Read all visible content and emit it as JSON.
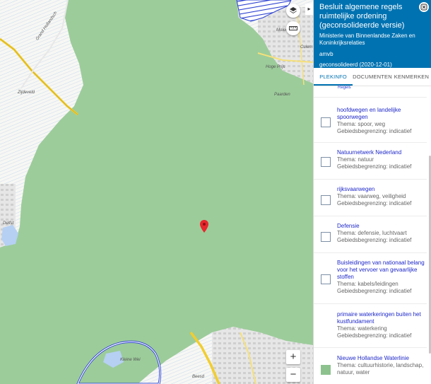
{
  "map": {
    "labels": {
      "zijdeveld": "Zijdeveld",
      "grand": "Grand Hollandsch",
      "molen": "Molen",
      "culemborg": "Culem",
      "hoge_prijs": "Hoge Prijs",
      "paarden": "Paarden",
      "delft": "Delfst",
      "kleine": "Kleine Wei",
      "beesd": "Beesd"
    },
    "zoom_in": "+",
    "zoom_out": "−",
    "collapse": "▸"
  },
  "panel": {
    "title": "Besluit algemene regels ruimtelijke ordening (geconsolideerde versie)",
    "publisher": "Ministerie van Binnenlandse Zaken en Koninkrijksrelaties",
    "type": "amvb",
    "status": "geconsolideerd (2020-12-01)",
    "tabs": [
      "PLEKINFO",
      "DOCUMENTEN",
      "KENMERKEN"
    ],
    "regels_link": "Regels",
    "items": [
      {
        "title": "hoofdwegen en landelijke spoorwegen",
        "thema": "Thema: spoor, weg",
        "grens": "Gebiedsbegrenzing: indicatief"
      },
      {
        "title": "Natuurnetwerk Nederland",
        "thema": "Thema: natuur",
        "grens": "Gebiedsbegrenzing: indicatief"
      },
      {
        "title": "rijksvaarwegen",
        "thema": "Thema: vaarweg, veiligheid",
        "grens": "Gebiedsbegrenzing: indicatief"
      },
      {
        "title": "Defensie",
        "thema": "Thema: defensie, luchtvaart",
        "grens": "Gebiedsbegrenzing: indicatief"
      },
      {
        "title": "Buisleidingen van nationaal belang voor het vervoer van gevaarlijke stoffen",
        "thema": "Thema: kabels/leidingen",
        "grens": "Gebiedsbegrenzing: indicatief"
      },
      {
        "title": "primaire waterkeringen buiten het kustfundament",
        "thema": "Thema: waterkering",
        "grens": "Gebiedsbegrenzing: indicatief"
      },
      {
        "title": "Nieuwe Hollandse Waterlinie",
        "thema": "Thema: cultuurhistorie, landschap, natuur, water",
        "grens": ""
      }
    ]
  }
}
